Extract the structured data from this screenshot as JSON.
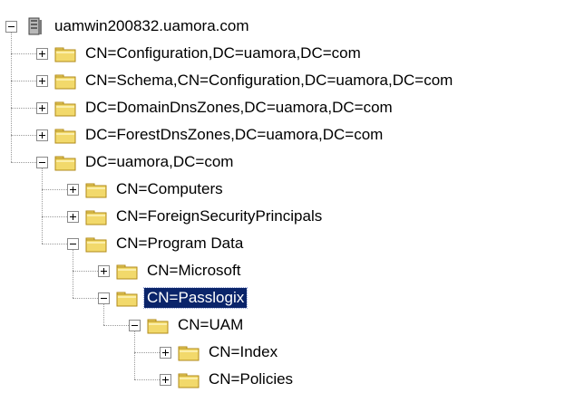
{
  "tree": {
    "root": {
      "label": "uamwin200832.uamora.com",
      "icon": "server-icon"
    },
    "nodes": [
      {
        "label": "CN=Configuration,DC=uamora,DC=com",
        "level": 1,
        "expanded": false,
        "selected": false
      },
      {
        "label": "CN=Schema,CN=Configuration,DC=uamora,DC=com",
        "level": 1,
        "expanded": false,
        "selected": false
      },
      {
        "label": "DC=DomainDnsZones,DC=uamora,DC=com",
        "level": 1,
        "expanded": false,
        "selected": false
      },
      {
        "label": "DC=ForestDnsZones,DC=uamora,DC=com",
        "level": 1,
        "expanded": false,
        "selected": false
      },
      {
        "label": "DC=uamora,DC=com",
        "level": 1,
        "expanded": true,
        "selected": false
      },
      {
        "label": "CN=Computers",
        "level": 2,
        "expanded": false,
        "selected": false
      },
      {
        "label": "CN=ForeignSecurityPrincipals",
        "level": 2,
        "expanded": false,
        "selected": false
      },
      {
        "label": "CN=Program Data",
        "level": 2,
        "expanded": true,
        "selected": false
      },
      {
        "label": "CN=Microsoft",
        "level": 3,
        "expanded": false,
        "selected": false
      },
      {
        "label": "CN=Passlogix",
        "level": 3,
        "expanded": true,
        "selected": true
      },
      {
        "label": "CN=UAM",
        "level": 4,
        "expanded": true,
        "selected": false
      },
      {
        "label": "CN=Index",
        "level": 5,
        "expanded": false,
        "selected": false
      },
      {
        "label": "CN=Policies",
        "level": 5,
        "expanded": false,
        "selected": false
      }
    ]
  },
  "colors": {
    "selection_bg": "#0a246a",
    "selection_text": "#ffffff",
    "folder_fill": "#f2d96b",
    "folder_border": "#b08a1a"
  },
  "icons": {
    "node": "folder-icon",
    "expander_collapsed": "plus-box-icon",
    "expander_expanded": "minus-box-icon"
  }
}
